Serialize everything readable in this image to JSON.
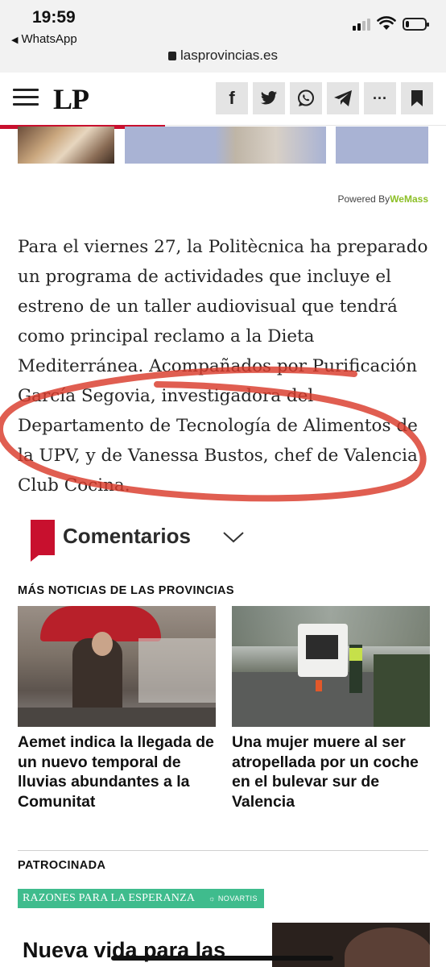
{
  "status_bar": {
    "time": "19:59",
    "back_app": "WhatsApp",
    "url": "lasprovincias.es",
    "signal_bars": 2,
    "battery_level": 0.2
  },
  "header": {
    "logo": "LP",
    "share_buttons": [
      {
        "icon": "facebook-icon",
        "glyph": "f"
      },
      {
        "icon": "twitter-icon",
        "glyph": ""
      },
      {
        "icon": "whatsapp-icon",
        "glyph": ""
      },
      {
        "icon": "telegram-icon",
        "glyph": ""
      },
      {
        "icon": "more-icon",
        "glyph": "···"
      },
      {
        "icon": "bookmark-icon",
        "glyph": ""
      }
    ],
    "reading_progress": 0.37,
    "accent_color": "#c8102e"
  },
  "ad": {
    "powered_prefix": "Powered By",
    "powered_brand": "WeMass"
  },
  "article": {
    "paragraph": "Para el viernes 27, la Politècnica ha preparado un programa de actividades que incluye el estreno de un taller audiovisual que tendrá como principal reclamo a la Dieta Mediterránea. Acompañados por Purificación García Segovia, investigadora del Departamento de Tecnología de Alimentos de la UPV, y de Vanessa Bustos, chef de Valencia Club Cocina."
  },
  "comments": {
    "label": "Comentarios"
  },
  "more_news": {
    "title": "MÁS NOTICIAS DE LAS PROVINCIAS",
    "items": [
      {
        "headline": "Aemet indica la llegada de un nuevo temporal de lluvias abundantes a la Comunitat"
      },
      {
        "headline": "Una mujer muere al ser atropellada por un coche en el bulevar sur de Valencia"
      }
    ]
  },
  "sponsored": {
    "title": "PATROCINADA",
    "banner_left": "RAZONES PARA LA ESPERANZA",
    "banner_right": "NOVARTIS",
    "banner_color": "#3fbc8d",
    "headline": "Nueva vida para las"
  }
}
